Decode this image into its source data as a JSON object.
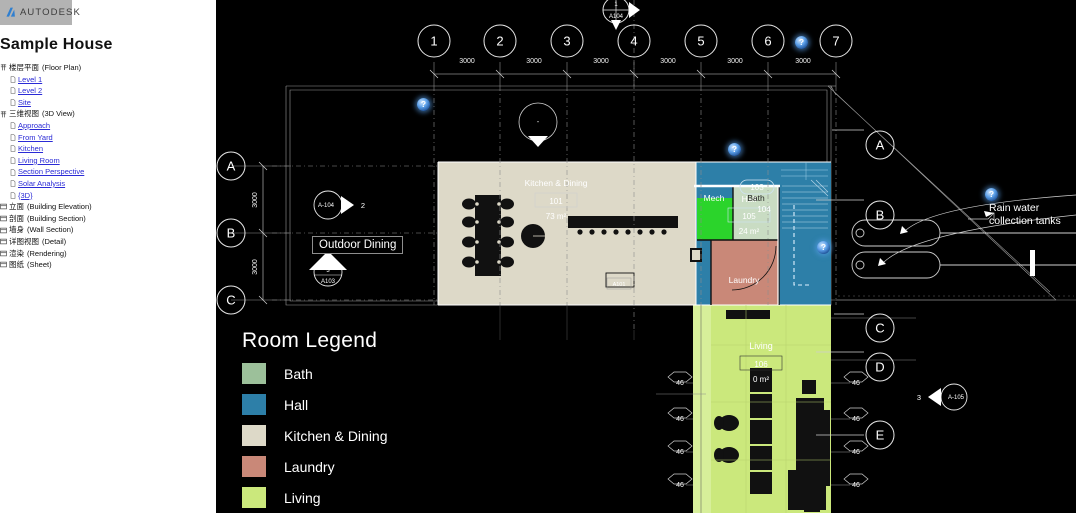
{
  "app": {
    "brand": "AUTODESK",
    "project_title": "Sample House"
  },
  "sidebar": {
    "groups": [
      {
        "cn": "楼层平面",
        "en": "(Floor Plan)",
        "children": [
          "Level 1",
          "Level 2",
          "Site"
        ]
      },
      {
        "cn": "三维视图",
        "en": "(3D View)",
        "children": [
          "Approach",
          "From Yard",
          "Kitchen",
          "Living Room",
          "Section Perspective",
          "Solar Analysis",
          "{3D}"
        ]
      },
      {
        "cn": "立面",
        "en": "(Building Elevation)",
        "children": []
      },
      {
        "cn": "剖面",
        "en": "(Building Section)",
        "children": []
      },
      {
        "cn": "墙身",
        "en": "(Wall Section)",
        "children": []
      },
      {
        "cn": "详图视图",
        "en": "(Detail)",
        "children": []
      },
      {
        "cn": "渲染",
        "en": "(Rendering)",
        "children": []
      },
      {
        "cn": "图纸",
        "en": "(Sheet)",
        "children": []
      }
    ]
  },
  "plan": {
    "grid_top": [
      "1",
      "2",
      "3",
      "4",
      "5",
      "6",
      "7"
    ],
    "grid_top_dims": [
      "3000",
      "3000",
      "3000",
      "3000",
      "3000",
      "3000"
    ],
    "grid_left": [
      "A",
      "B",
      "C"
    ],
    "grid_left_dims": [
      "3000",
      "3000"
    ],
    "grid_right": [
      "A",
      "B",
      "C",
      "D",
      "E"
    ],
    "rooms": [
      {
        "name": "Kitchen & Dining",
        "number": "101",
        "area": "73 m²"
      },
      {
        "name": "Hall",
        "number": "105",
        "area": "24 m²"
      },
      {
        "name": "Bath",
        "number": "104",
        "area": ""
      },
      {
        "name": "Mech",
        "number": "",
        "area": ""
      },
      {
        "name": "Laundry",
        "number": "",
        "area": ""
      },
      {
        "name": "Living",
        "number": "106",
        "area": "0 m²"
      }
    ],
    "door_tag": "103",
    "outdoor_label": "Outdoor Dining",
    "section_markers": [
      {
        "number": "1",
        "sheet": "A104"
      },
      {
        "number": "2",
        "sheet": "A-104"
      },
      {
        "number": "3",
        "sheet": "A103"
      },
      {
        "number": "3",
        "sheet": "A-105"
      }
    ],
    "window_tags": [
      "46",
      "46",
      "46",
      "46",
      "46",
      "46",
      "46",
      "46"
    ],
    "annotation": {
      "icon": "cloud-question-icon",
      "text_line1": "Rain water",
      "text_line2": "collection tanks"
    },
    "question_badges": [
      "?",
      "?",
      "?",
      "?",
      "?"
    ],
    "badge_glyph": "?"
  },
  "legend": {
    "title": "Room Legend",
    "items": [
      {
        "label": "Bath",
        "color": "#9cc09a"
      },
      {
        "label": "Hall",
        "color": "#2d7fa8"
      },
      {
        "label": "Kitchen & Dining",
        "color": "#ddd9c8"
      },
      {
        "label": "Laundry",
        "color": "#c98878"
      },
      {
        "label": "Living",
        "color": "#cbe87c"
      }
    ]
  },
  "colors": {
    "background": "#000000",
    "panel": "#ffffff",
    "link": "#2a2ad6",
    "accent_badge": "#5b9fe8",
    "mech_highlight": "#2bd42b"
  }
}
